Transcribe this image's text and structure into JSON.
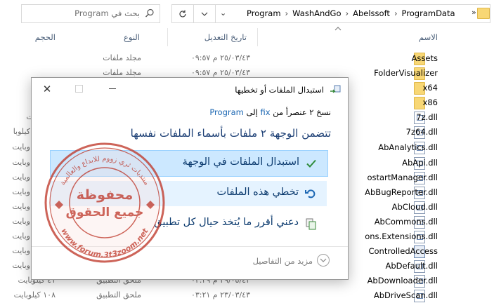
{
  "explorer": {
    "search_placeholder": "بحث في Program",
    "breadcrumb": [
      "Program",
      "WashAndGo",
      "Abelssoft",
      "ProgramData"
    ],
    "breadcrumb_overflow": "»",
    "columns": {
      "name": "الاسم",
      "date": "تاريخ التعديل",
      "type": "النوع",
      "size": "الحجم"
    },
    "rows": [
      {
        "name": "Assets",
        "kind": "folder",
        "date": "٢٥/٠٣/٤٣ م ٠٩:٥٧",
        "type": "مجلد ملفات",
        "size": ""
      },
      {
        "name": "FolderVisualizer",
        "kind": "folder",
        "date": "٢٥/٠٣/٤٣ م ٠٩:٥٧",
        "type": "مجلد ملفات",
        "size": ""
      },
      {
        "name": "x64",
        "kind": "folder",
        "date": "",
        "type": "",
        "size": ""
      },
      {
        "name": "x86",
        "kind": "folder",
        "date": "",
        "type": "",
        "size": ""
      },
      {
        "name": "7z.dll",
        "kind": "dll",
        "date": "",
        "type": "",
        "size": "وبايت"
      },
      {
        "name": "7z64.dll",
        "kind": "dll",
        "date": "",
        "type": "",
        "size": "كيلوبا"
      },
      {
        "name": "AbAnalytics.dll",
        "kind": "dll",
        "date": "",
        "type": "",
        "size": "وبايت"
      },
      {
        "name": "AbApi.dll",
        "kind": "dll",
        "date": "",
        "type": "",
        "size": "وبايت"
      },
      {
        "name": "ostartManager.dll",
        "kind": "dll",
        "date": "",
        "type": "",
        "size": "وبايت"
      },
      {
        "name": "AbBugReporter.dll",
        "kind": "dll",
        "date": "",
        "type": "",
        "size": "وبايت"
      },
      {
        "name": "AbCloud.dll",
        "kind": "dll",
        "date": "",
        "type": "",
        "size": "وبايت"
      },
      {
        "name": "AbCommons.dll",
        "kind": "dll",
        "date": "",
        "type": "",
        "size": "وبايت"
      },
      {
        "name": "ons.Extensions.dll",
        "kind": "dll",
        "date": "",
        "type": "",
        "size": "وبايت"
      },
      {
        "name": "ControlledAccess",
        "kind": "app",
        "date": "",
        "type": "",
        "size": "وبايت"
      },
      {
        "name": "AbDefault.dll",
        "kind": "dll",
        "date": "",
        "type": "",
        "size": "وبايت"
      },
      {
        "name": "AbDownloader.dll",
        "kind": "dll",
        "date": "٢٩/٠٥/٤٢ م ٠٢:٣٩",
        "type": "ملحق التطبيق",
        "size": "٤١ كيلوبايت"
      },
      {
        "name": "AbDriveScan.dll",
        "kind": "dll",
        "date": "٢٣/٠٣/٤٣ م ٠٣:٢١",
        "type": "ملحق التطبيق",
        "size": "١٠٨ كيلوبايت"
      }
    ]
  },
  "dialog": {
    "title": "استبدال الملفات أو تخطيها",
    "subtitle_prefix": "نسخ ٢ عنصرأ من",
    "source": "fix",
    "subtitle_mid": "إلى",
    "destination": "Program",
    "heading": "تتضمن الوجهة ٢ ملفات بأسماء الملفات نفسها",
    "options": [
      {
        "label": "استبدال الملفات في الوجهة",
        "icon": "checkmark-icon"
      },
      {
        "label": "تخطي هذه الملفات",
        "icon": "undo-arrow-icon"
      },
      {
        "label": "دعني أقرر ما يُتخذ حيال كل تطبيق",
        "icon": "compare-files-icon"
      }
    ],
    "more_details": "مزيد من التفاصيل"
  },
  "watermark": {
    "center_line1": "محفوظة",
    "center_line2": "جميع الحقوق",
    "arc_top": "منتديات ثري زووم للابداع والعالمية",
    "arc_bottom": "www.forum.3t3zoom.net"
  },
  "colors": {
    "accent": "#1c67b3",
    "option_selected": "#cce8ff",
    "option_hover": "#e5f3ff",
    "stamp_red": "#c0392b",
    "folder_yellow": "#f8d775"
  }
}
